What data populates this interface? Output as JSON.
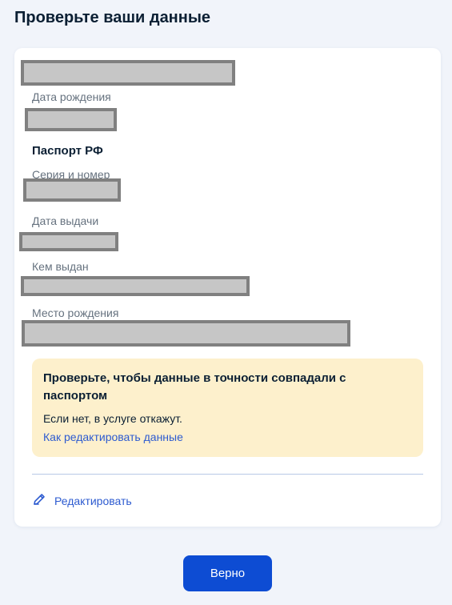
{
  "page": {
    "title": "Проверьте ваши данные"
  },
  "card": {
    "fields": {
      "birth_date_label": "Дата рождения",
      "passport_section_title": "Паспорт РФ",
      "series_number_label": "Серия и номер",
      "issue_date_label": "Дата выдачи",
      "issued_by_label": "Кем выдан",
      "birth_place_label": "Место рождения"
    },
    "notice": {
      "title": "Проверьте, чтобы данные в точности совпадали с паспортом",
      "text": "Если нет, в услуге откажут.",
      "link": "Как редактировать данные"
    },
    "edit_label": "Редактировать"
  },
  "confirm_button": "Верно",
  "icons": {
    "edit": "pencil-icon"
  },
  "colors": {
    "primary": "#0d4cd3",
    "link": "#2d5bd0",
    "notice_bg": "#fdf0cc",
    "page_bg": "#f1f4fa"
  }
}
